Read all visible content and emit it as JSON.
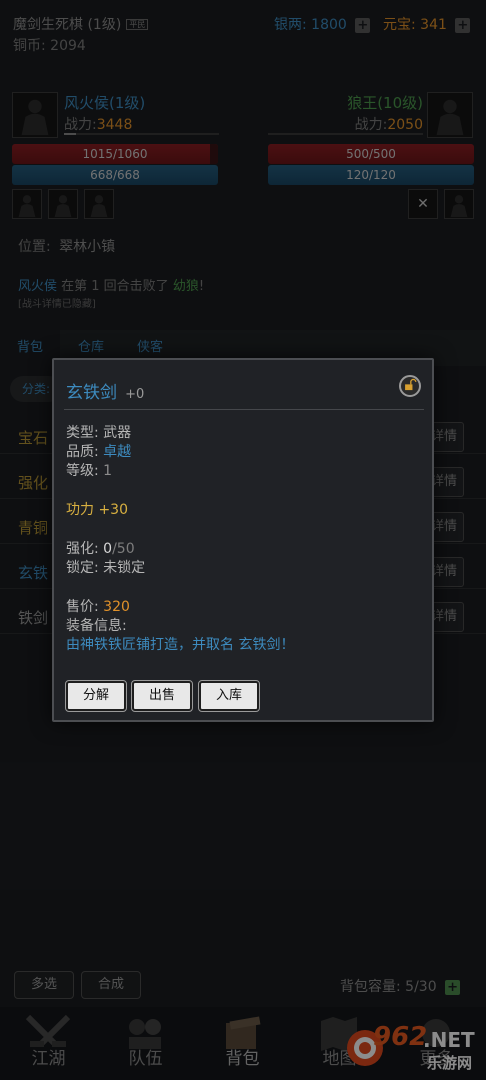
{
  "header": {
    "title": "魔剑生死棋 (1级)",
    "badge": "平民",
    "copper_label": "铜币:",
    "copper_value": "2094",
    "silver_label": "银两:",
    "silver_value": "1800",
    "gold_label": "元宝:",
    "gold_value": "341"
  },
  "battle": {
    "player": {
      "name": "风火侯(1级)",
      "power_label": "战力:",
      "power_value": "3448",
      "hp": "1015/1060",
      "mp": "668/668",
      "hp_fraction": 0.957,
      "mp_fraction": 1.0
    },
    "enemy": {
      "name": "狼王(10级)",
      "power_label": "战力:",
      "power_value": "2050",
      "hp": "500/500",
      "mp": "120/120",
      "hp_fraction": 1.0,
      "mp_fraction": 1.0
    },
    "location_label": "位置:",
    "location_value": "翠林小镇",
    "log_actor": "风火侯",
    "log_text": " 在第 1 回合击败了 ",
    "log_target": "幼狼",
    "log_end": "!",
    "log_hidden": "[战斗详情已隐藏]",
    "close_glyph": "✕"
  },
  "tabs": [
    "背包",
    "仓库",
    "侠客"
  ],
  "inventory": {
    "filter_label": "分类:",
    "items": [
      {
        "name": "宝石",
        "color": "#b59434",
        "detail": "详情"
      },
      {
        "name": "强化",
        "color": "#b59434",
        "detail": "详情"
      },
      {
        "name": "青铜",
        "color": "#b59434",
        "detail": "详情"
      },
      {
        "name": "玄铁",
        "color": "#3d8bbf",
        "detail": "详情"
      },
      {
        "name": "铁剑",
        "color": "#9a9a9a",
        "detail": "详情"
      }
    ],
    "multi_select": "多选",
    "combine": "合成",
    "capacity_label": "背包容量:",
    "capacity_value": "5/30"
  },
  "modal": {
    "item_name": "玄铁剑",
    "item_level": "+0",
    "type_label": "类型:",
    "type_value": "武器",
    "quality_label": "品质:",
    "quality_value": "卓越",
    "grade_label": "等级:",
    "grade_value": "1",
    "attack": "功力 +30",
    "enhance_label": "强化:",
    "enhance_current": "0",
    "enhance_max": "/50",
    "lock_label": "锁定:",
    "lock_value": "未锁定",
    "price_label": "售价:",
    "price_value": "320",
    "info_label": "装备信息:",
    "info_text": "由神铁铁匠铺打造，并取名 玄铁剑！",
    "btn_dismantle": "分解",
    "btn_sell": "出售",
    "btn_store": "入库"
  },
  "bottom_nav": [
    "江湖",
    "队伍",
    "背包",
    "地图",
    "更多"
  ],
  "watermark": {
    "text": "962",
    "suffix": ".NET",
    "sub": "乐游网"
  },
  "colors": {
    "accent_blue": "#3d8bbf",
    "gold": "#d8b040",
    "orange_value": "#e0912a",
    "hp_red": "#8a1e22",
    "mp_blue": "#245d7e"
  }
}
